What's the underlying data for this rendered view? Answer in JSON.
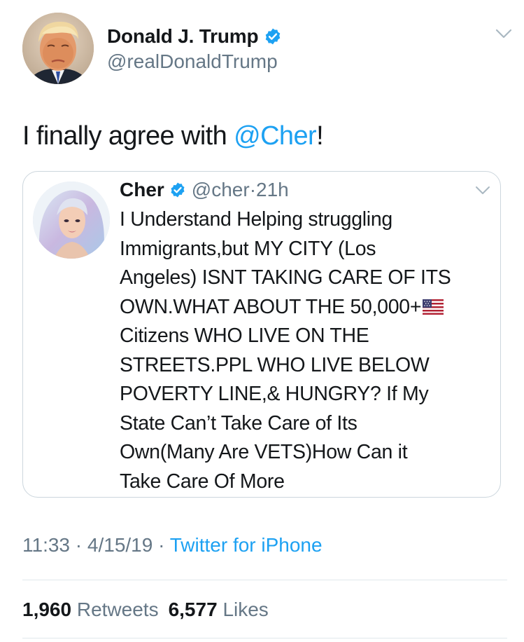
{
  "author": {
    "display_name": "Donald J. Trump",
    "handle": "@realDonaldTrump",
    "verified": true,
    "avatar": "trump-avatar"
  },
  "tweet": {
    "text_before": "I finally agree with ",
    "mention": "@Cher",
    "text_after": "!"
  },
  "quoted_tweet": {
    "display_name": "Cher",
    "handle": "@cher",
    "separator": " · ",
    "time": "21h",
    "verified": true,
    "avatar": "cher-avatar",
    "lines": [
      "I Understand Helping struggling",
      "Immigrants,but MY CITY (Los",
      "Angeles) ISNT TAKING CARE OF ITS",
      "OWN.WHAT ABOUT THE 50,000+",
      "Citizens WHO LIVE ON THE",
      "STREETS.PPL WHO LIVE BELOW",
      "POVERTY LINE,& HUNGRY? If My",
      "State Can’t Take Care of Its",
      "Own(Many Are VETS)How Can it",
      "Take Care Of More"
    ],
    "flag_emoji": "us-flag-icon"
  },
  "meta": {
    "time": "11:33",
    "sep1": " · ",
    "date": "4/15/19",
    "sep2": " · ",
    "source": "Twitter for iPhone"
  },
  "stats": {
    "retweets_count": "1,960",
    "retweets_label": "Retweets",
    "likes_count": "6,577",
    "likes_label": "Likes"
  },
  "colors": {
    "link_blue": "#1da1f2",
    "secondary_gray": "#657786",
    "text": "#14171a",
    "border": "#ccd6dd"
  }
}
